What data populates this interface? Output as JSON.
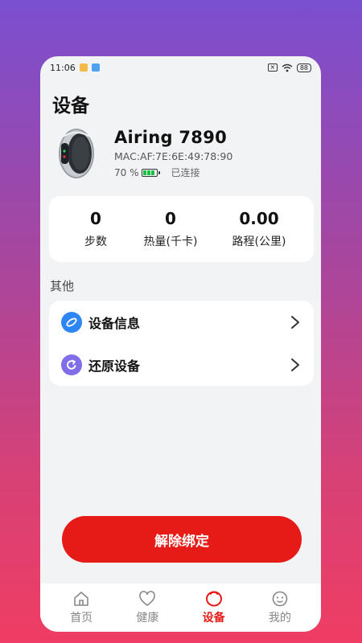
{
  "status_bar": {
    "time": "11:06",
    "battery": "88",
    "close_glyph": "×"
  },
  "page": {
    "title": "设备"
  },
  "device": {
    "name": "Airing 7890",
    "mac": "MAC:AF:7E:6E:49:78:90",
    "battery_percent": "70 %",
    "battery_level": 0.7,
    "connection_status": "已连接"
  },
  "stats": [
    {
      "value": "0",
      "label": "步数"
    },
    {
      "value": "0",
      "label": "热量(千卡)"
    },
    {
      "value": "0.00",
      "label": "路程(公里)"
    }
  ],
  "section": {
    "other_label": "其他"
  },
  "menu": [
    {
      "label": "设备信息",
      "icon": "device-info-icon"
    },
    {
      "label": "还原设备",
      "icon": "restore-icon"
    }
  ],
  "unbind_button": "解除绑定",
  "tabs": [
    {
      "label": "首页",
      "icon": "home-icon",
      "active": false
    },
    {
      "label": "健康",
      "icon": "heart-icon",
      "active": false
    },
    {
      "label": "设备",
      "icon": "ring-icon",
      "active": true
    },
    {
      "label": "我的",
      "icon": "smile-icon",
      "active": false
    }
  ],
  "colors": {
    "accent": "#e61b17",
    "battery_green": "#1bbf45",
    "info_icon": "#2c86f5",
    "reset_icon": "#7f6ee8"
  }
}
